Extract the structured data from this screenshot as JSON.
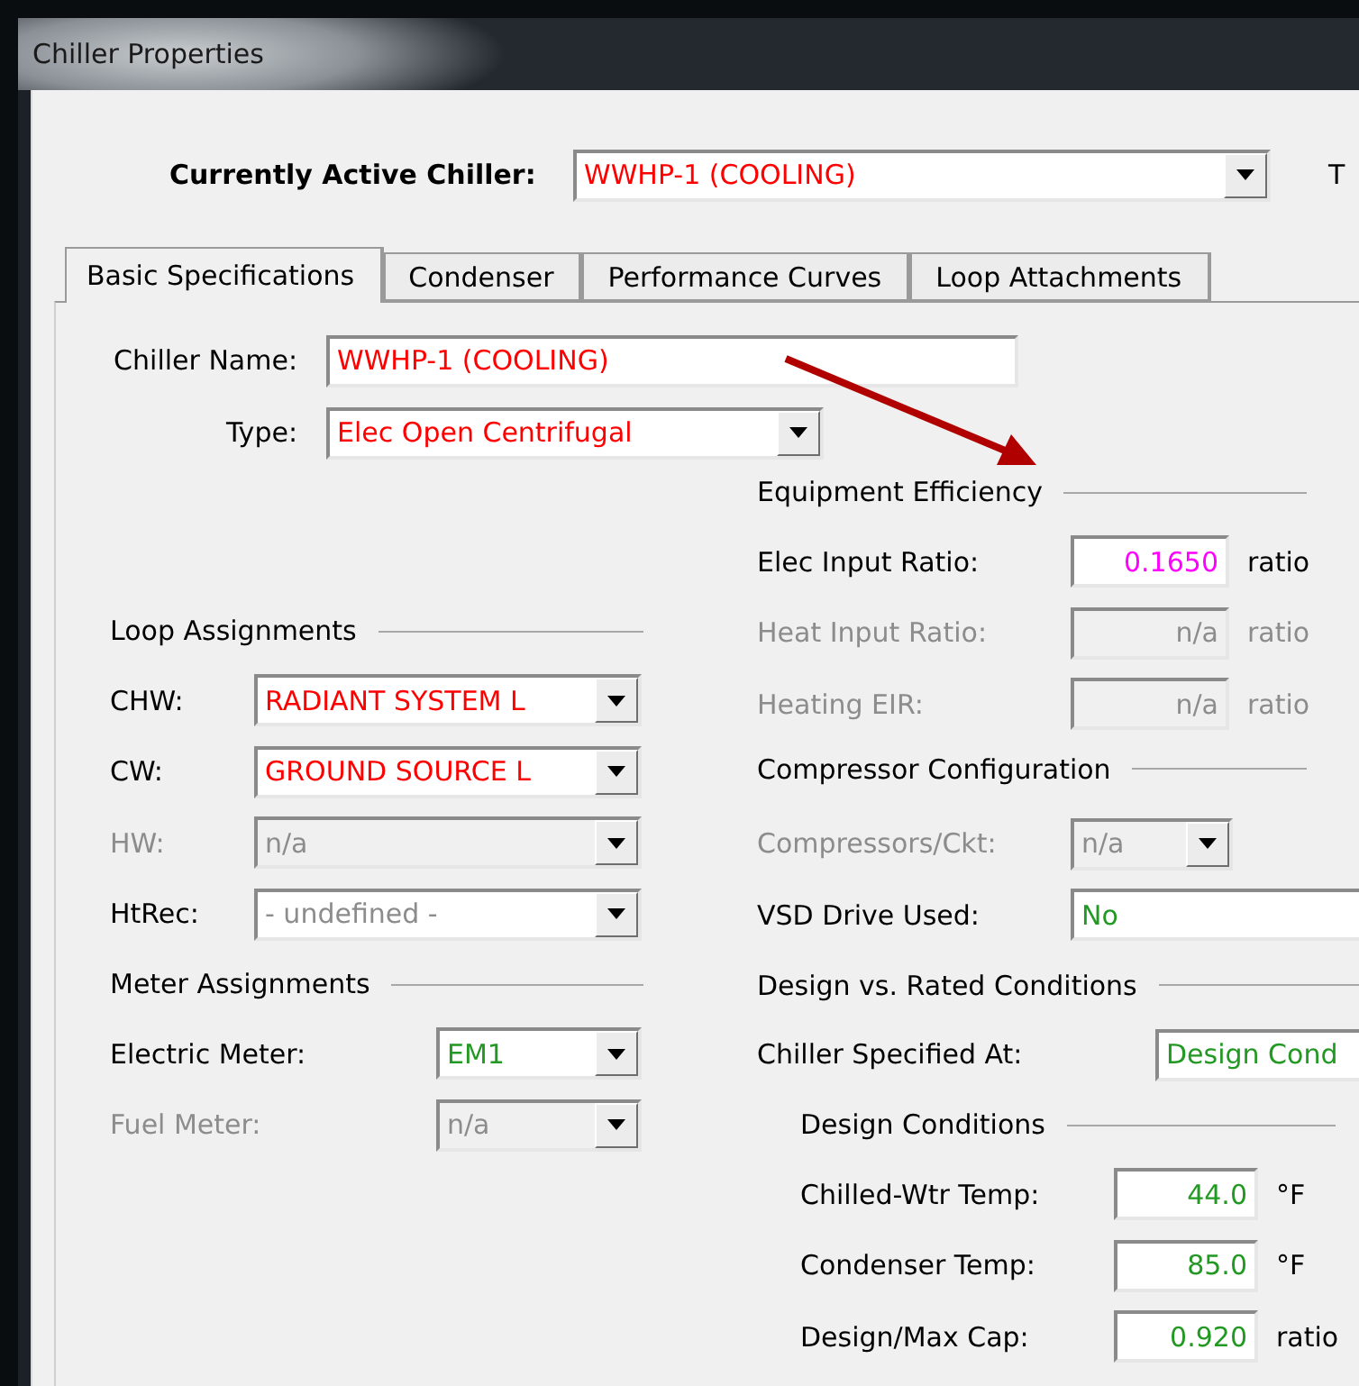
{
  "window": {
    "title": "Chiller Properties"
  },
  "active_chiller": {
    "label": "Currently Active Chiller:",
    "value": "WWHP-1 (COOLING)",
    "color": "#ff0000"
  },
  "cut_label": "T",
  "tabs": [
    {
      "label": "Basic Specifications",
      "selected": true
    },
    {
      "label": "Condenser",
      "selected": false
    },
    {
      "label": "Performance Curves",
      "selected": false
    },
    {
      "label": "Loop Attachments",
      "selected": false
    }
  ],
  "chiller_name": {
    "label": "Chiller Name:",
    "value": "WWHP-1 (COOLING)",
    "color": "#ff0000"
  },
  "chiller_type": {
    "label": "Type:",
    "value": "Elec Open Centrifugal",
    "color": "#ff0000"
  },
  "left_sections": [
    {
      "title": "Loop Assignments",
      "rows": [
        {
          "label": "CHW:",
          "kind": "combo",
          "value": "RADIANT SYSTEM L",
          "color": "#ff0000",
          "disabled": false
        },
        {
          "label": "CW:",
          "kind": "combo",
          "value": "GROUND SOURCE L",
          "color": "#ff0000",
          "disabled": false
        },
        {
          "label": "HW:",
          "kind": "combo",
          "value": "n/a",
          "color": "#8c8c8c",
          "disabled": true
        },
        {
          "label": "HtRec:",
          "kind": "combo",
          "value": "- undefined -",
          "color": "#8c8c8c",
          "disabled": false
        }
      ]
    },
    {
      "title": "Meter Assignments",
      "rows": [
        {
          "label": "Electric Meter:",
          "kind": "combo",
          "value": "EM1",
          "color": "#229922",
          "disabled": false
        },
        {
          "label": "Fuel Meter:",
          "kind": "combo",
          "value": "n/a",
          "color": "#8c8c8c",
          "disabled": true
        }
      ]
    }
  ],
  "right_sections": [
    {
      "title": "Equipment Efficiency",
      "rows": [
        {
          "label": "Elec Input Ratio:",
          "kind": "number",
          "value": "0.1650",
          "unit": "ratio",
          "color": "#ff00ff",
          "disabled": false
        },
        {
          "label": "Heat Input Ratio:",
          "kind": "number",
          "value": "n/a",
          "unit": "ratio",
          "color": "#8c8c8c",
          "disabled": true
        },
        {
          "label": "Heating EIR:",
          "kind": "number",
          "value": "n/a",
          "unit": "ratio",
          "color": "#8c8c8c",
          "disabled": true
        }
      ]
    },
    {
      "title": "Compressor Configuration",
      "rows": [
        {
          "label": "Compressors/Ckt:",
          "kind": "combo",
          "value": "n/a",
          "color": "#8c8c8c",
          "disabled": true
        },
        {
          "label": "VSD Drive Used:",
          "kind": "wide",
          "value": "No",
          "color": "#229922",
          "disabled": false
        }
      ]
    },
    {
      "title": "Design vs. Rated Conditions",
      "rows": [
        {
          "label": "Chiller Specified At:",
          "kind": "wide",
          "value": "Design Cond",
          "color": "#229922",
          "disabled": false
        }
      ]
    },
    {
      "title": "Design Conditions",
      "rows": [
        {
          "label": "Chilled-Wtr Temp:",
          "kind": "number",
          "value": "44.0",
          "unit": "°F",
          "color": "#229922",
          "disabled": false
        },
        {
          "label": "Condenser Temp:",
          "kind": "number",
          "value": "85.0",
          "unit": "°F",
          "color": "#229922",
          "disabled": false
        },
        {
          "label": "Design/Max Cap:",
          "kind": "number",
          "value": "0.920",
          "unit": "ratio",
          "color": "#229922",
          "disabled": false
        }
      ]
    }
  ]
}
